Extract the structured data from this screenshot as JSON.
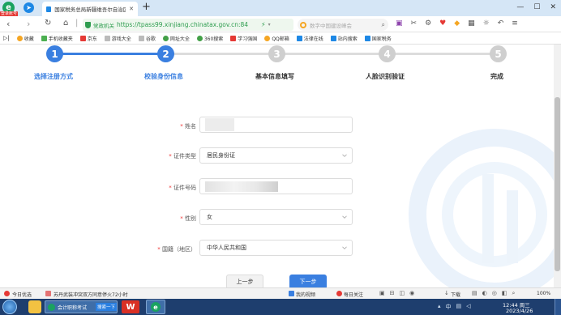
{
  "browser": {
    "badge": "登录账号",
    "tab_title": "国家税务总局新疆维吾尔自治区",
    "new_tab": "+",
    "site_name": "党政机关",
    "url": "https://tpass99.xinjiang.chinatax.gov.cn:84",
    "search_placeholder": "数字中国建设峰会",
    "bookmarks": [
      {
        "label": "收藏",
        "color": "#f5a623"
      },
      {
        "label": "手机收藏夹",
        "color": "#4caf50"
      },
      {
        "label": "京东",
        "color": "#e53935"
      },
      {
        "label": "游戏大全",
        "color": "#888888"
      },
      {
        "label": "谷歌",
        "color": "#888888"
      },
      {
        "label": "网址大全",
        "color": "#43a047"
      },
      {
        "label": "360搜索",
        "color": "#43a047"
      },
      {
        "label": "学习强国",
        "color": "#e53935"
      },
      {
        "label": "QQ邮箱",
        "color": "#f5a623"
      },
      {
        "label": "法律在线",
        "color": "#1e88e5"
      },
      {
        "label": "站内搜索",
        "color": "#1e88e5"
      },
      {
        "label": "国家税务",
        "color": "#1e88e5"
      }
    ]
  },
  "steps": [
    {
      "num": "1",
      "label": "选择注册方式",
      "state": "done"
    },
    {
      "num": "2",
      "label": "校验身份信息",
      "state": "done"
    },
    {
      "num": "3",
      "label": "基本信息填写",
      "state": "todo"
    },
    {
      "num": "4",
      "label": "人脸识别验证",
      "state": "todo"
    },
    {
      "num": "5",
      "label": "完成",
      "state": "todo"
    }
  ],
  "form": {
    "required_mark": "*",
    "name_label": "姓名",
    "name_value": "",
    "id_type_label": "证件类型",
    "id_type_value": "居民身份证",
    "id_number_label": "证件号码",
    "id_number_value": "",
    "gender_label": "性别",
    "gender_value": "女",
    "nationality_label": "国籍（地区）",
    "nationality_value": "中华人民共和国"
  },
  "buttons": {
    "prev": "上一步",
    "next": "下一步"
  },
  "statusbar": {
    "left": "今日优选",
    "news": "苏丹武装冲突双方同意停火72小时",
    "my_video": "我的视频",
    "daily": "每日关注",
    "download": "下载",
    "zoom": "100%"
  },
  "taskbar": {
    "task_label": "会计职称考试",
    "task_search": "搜索一下",
    "time": "12:44 周三",
    "date": "2023/4/26"
  },
  "colors": {
    "accent": "#3a7fe0",
    "inactive": "#cfcfcf",
    "taskbar": "#1e3e6e"
  }
}
